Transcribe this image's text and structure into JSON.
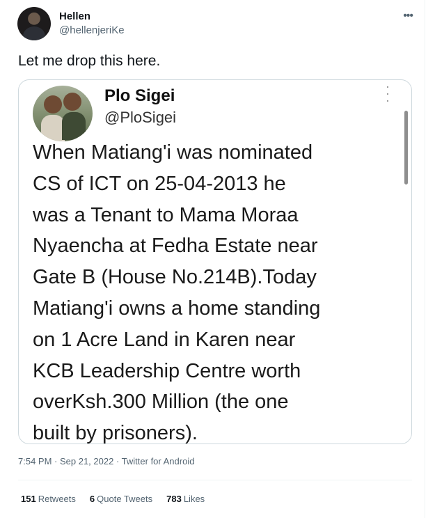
{
  "tweet": {
    "display_name": "Hellen",
    "handle": "@hellenjeriKe",
    "text": "Let me drop this here.",
    "more_icon": "more-horizontal-icon"
  },
  "quoted": {
    "display_name": "Plo Sigei",
    "handle": "@PloSigei",
    "more_icon": "more-vertical-icon",
    "lines": [
      "When Matiang'i was nominated",
      "CS of ICT on 25-04-2013 he",
      "was a Tenant to Mama Moraa",
      "Nyaencha at Fedha Estate near",
      "Gate B (House No.214B).Today",
      "Matiang'i owns a home standing",
      "on 1 Acre Land in Karen near",
      "KCB Leadership Centre worth",
      "overKsh.300 Million (the one",
      "built by prisoners)."
    ]
  },
  "meta": {
    "time": "7:54 PM",
    "sep1": " · ",
    "date": "Sep 21, 2022",
    "sep2": " · ",
    "source": "Twitter for Android"
  },
  "stats": {
    "retweets_count": "151",
    "retweets_label": "Retweets",
    "quotes_count": "6",
    "quotes_label": "Quote Tweets",
    "likes_count": "783",
    "likes_label": "Likes"
  }
}
